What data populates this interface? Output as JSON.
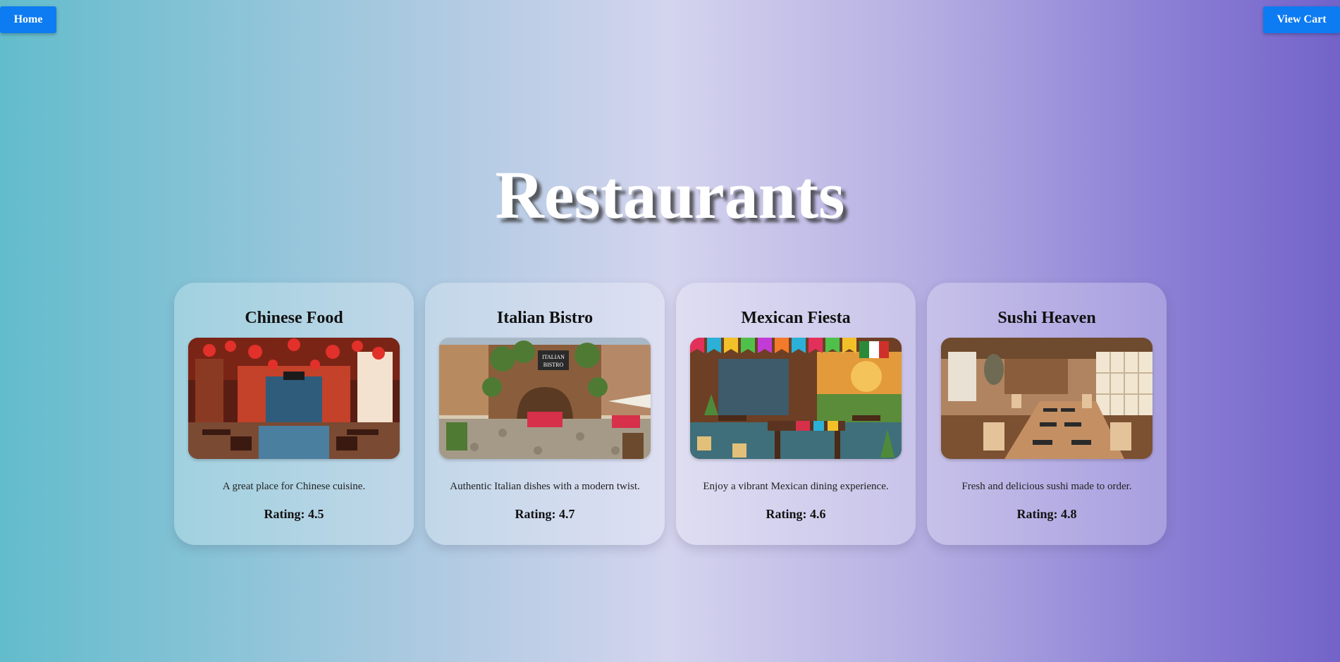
{
  "nav": {
    "home_label": "Home",
    "cart_label": "View Cart"
  },
  "page": {
    "title": "Restaurants"
  },
  "restaurants": [
    {
      "name": "Chinese Food",
      "description": "A great place for Chinese cuisine.",
      "rating": "Rating: 4.5",
      "image_icon": "chinese-restaurant-image"
    },
    {
      "name": "Italian Bistro",
      "description": "Authentic Italian dishes with a modern twist.",
      "rating": "Rating: 4.7",
      "image_icon": "italian-bistro-image",
      "image_sign": "ITALIAN BISTRO"
    },
    {
      "name": "Mexican Fiesta",
      "description": "Enjoy a vibrant Mexican dining experience.",
      "rating": "Rating: 4.6",
      "image_icon": "mexican-restaurant-image"
    },
    {
      "name": "Sushi Heaven",
      "description": "Fresh and delicious sushi made to order.",
      "rating": "Rating: 4.8",
      "image_icon": "sushi-restaurant-image"
    }
  ],
  "colors": {
    "button": "#0d7bf2",
    "gradient_start": "#62bccc",
    "gradient_end": "#7363c9"
  }
}
